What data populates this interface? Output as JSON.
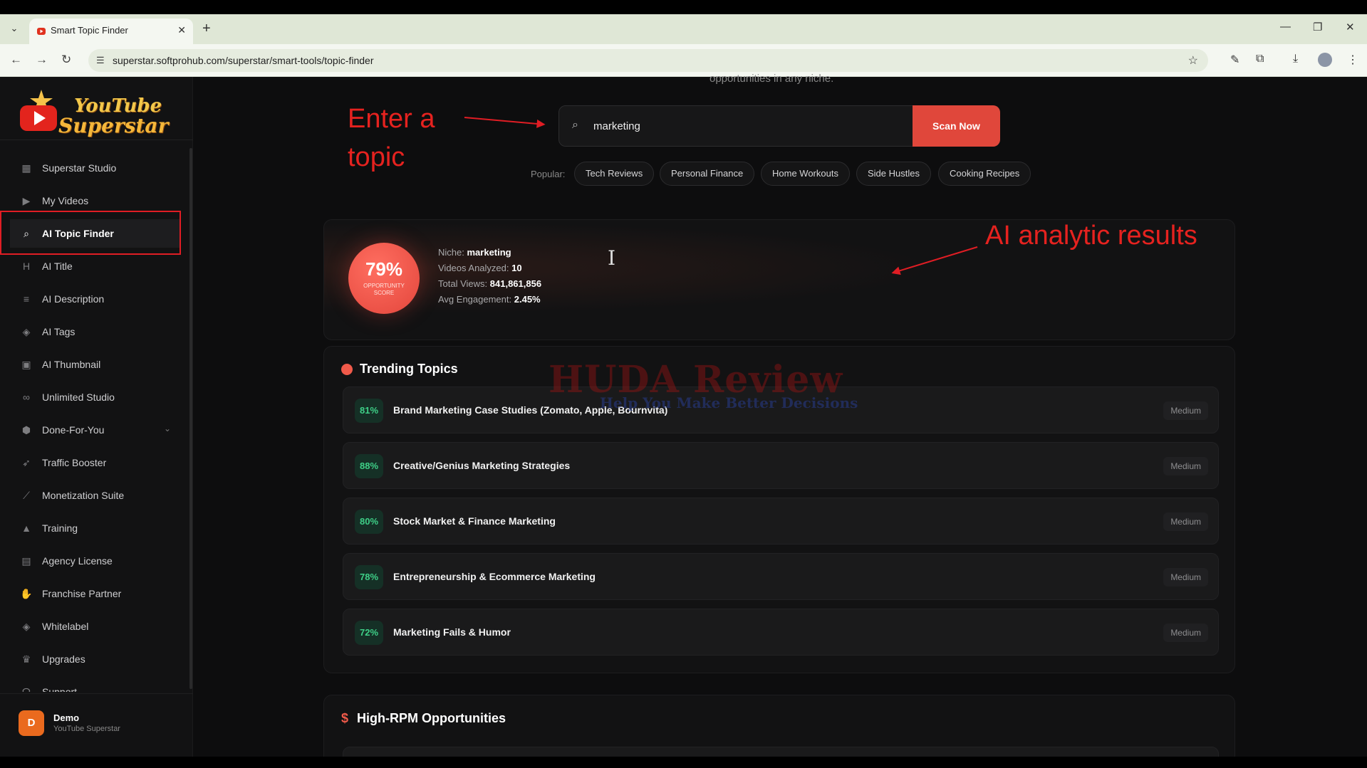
{
  "browser": {
    "tab_title": "Smart Topic Finder",
    "url": "superstar.softprohub.com/superstar/smart-tools/topic-finder"
  },
  "sidebar": {
    "logo_line1": "YouTube",
    "logo_line2": "Superstar",
    "items": [
      {
        "label": "Superstar Studio",
        "icon": "grid-icon"
      },
      {
        "label": "My Videos",
        "icon": "play-circle-icon"
      },
      {
        "label": "AI Topic Finder",
        "icon": "search-icon"
      },
      {
        "label": "AI Title",
        "icon": "heading-icon"
      },
      {
        "label": "AI Description",
        "icon": "align-left-icon"
      },
      {
        "label": "AI Tags",
        "icon": "tag-icon"
      },
      {
        "label": "AI Thumbnail",
        "icon": "image-icon"
      },
      {
        "label": "Unlimited Studio",
        "icon": "infinity-icon"
      },
      {
        "label": "Done-For-You",
        "icon": "box-icon"
      },
      {
        "label": "Traffic Booster",
        "icon": "rocket-icon"
      },
      {
        "label": "Monetization Suite",
        "icon": "chart-line-icon"
      },
      {
        "label": "Training",
        "icon": "graduation-cap-icon"
      },
      {
        "label": "Agency License",
        "icon": "building-icon"
      },
      {
        "label": "Franchise Partner",
        "icon": "handshake-icon"
      },
      {
        "label": "Whitelabel",
        "icon": "tag-icon"
      },
      {
        "label": "Upgrades",
        "icon": "crown-icon"
      },
      {
        "label": "Support",
        "icon": "headset-icon"
      }
    ],
    "active_item": "AI Topic Finder",
    "user": {
      "initial": "D",
      "name": "Demo",
      "subtitle": "YouTube Superstar"
    }
  },
  "main": {
    "header_cut_text": "opportunities in any niche.",
    "annotation_left": "Enter a topic",
    "annotation_right": "AI analytic results",
    "search": {
      "value": "marketing",
      "button": "Scan Now"
    },
    "popular": {
      "label": "Popular:",
      "chips": [
        "Tech Reviews",
        "Personal Finance",
        "Home Workouts",
        "Side Hustles",
        "Cooking Recipes"
      ]
    },
    "score": {
      "value": "79%",
      "caption": "OPPORTUNITY SCORE",
      "niche_label": "Niche:",
      "niche": "marketing",
      "videos_label": "Videos Analyzed:",
      "videos": "10",
      "views_label": "Total Views:",
      "views": "841,861,856",
      "engagement_label": "Avg Engagement:",
      "engagement": "2.45%"
    },
    "trending": {
      "title": "Trending Topics",
      "items": [
        {
          "pct": "81%",
          "title": "Brand Marketing Case Studies (Zomato, Apple, Bournvita)",
          "badge": "Medium"
        },
        {
          "pct": "88%",
          "title": "Creative/Genius Marketing Strategies",
          "badge": "Medium"
        },
        {
          "pct": "80%",
          "title": "Stock Market & Finance Marketing",
          "badge": "Medium"
        },
        {
          "pct": "78%",
          "title": "Entrepreneurship & Ecommerce Marketing",
          "badge": "Medium"
        },
        {
          "pct": "72%",
          "title": "Marketing Fails & Humor",
          "badge": "Medium"
        }
      ]
    },
    "rpm": {
      "title": "High-RPM Opportunities"
    },
    "watermark_line1": "HUDA Review",
    "watermark_line2": "Help You Make Better Decisions"
  }
}
